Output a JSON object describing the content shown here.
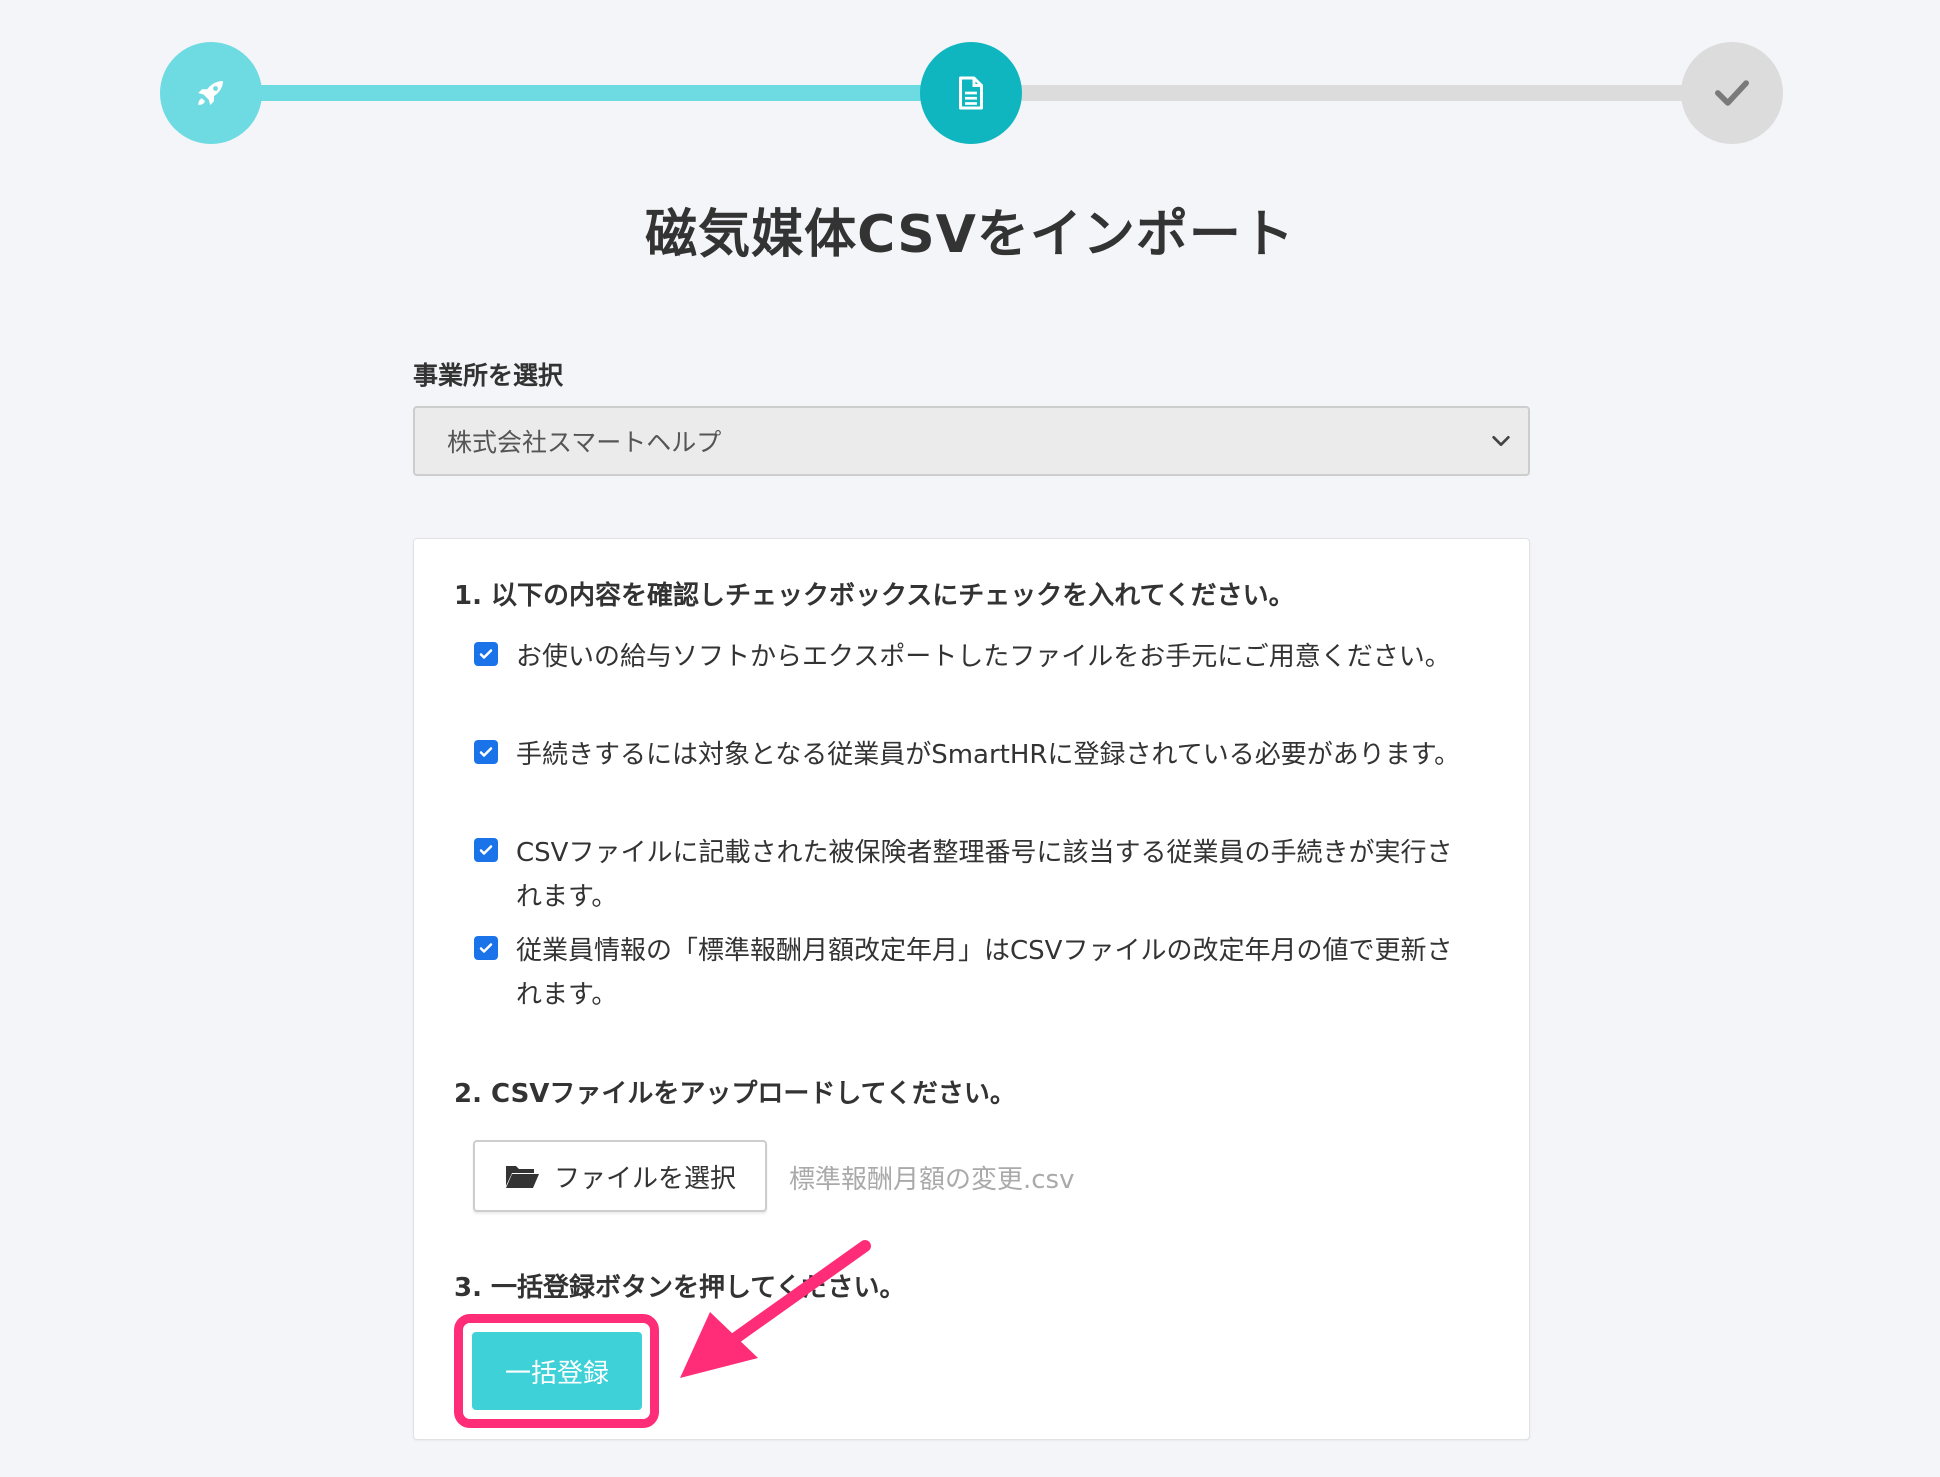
{
  "stepper": {
    "steps": [
      {
        "icon": "rocket-icon",
        "state": "completed"
      },
      {
        "icon": "document-icon",
        "state": "current"
      },
      {
        "icon": "check-icon",
        "state": "upcoming"
      }
    ],
    "colors": {
      "done": "#6ddbe1",
      "current": "#10b6bf",
      "todo": "#dcdcdc"
    }
  },
  "page": {
    "title": "磁気媒体CSVをインポート"
  },
  "office": {
    "label": "事業所を選択",
    "selected": "株式会社スマートヘルプ"
  },
  "section1": {
    "heading": "1. 以下の内容を確認しチェックボックスにチェックを入れてください。",
    "items": [
      {
        "text": "お使いの給与ソフトからエクスポートしたファイルをお手元にご用意ください。",
        "checked": true
      },
      {
        "text": "手続きするには対象となる従業員がSmartHRに登録されている必要があります。",
        "checked": true
      },
      {
        "text": "CSVファイルに記載された被保険者整理番号に該当する従業員の手続きが実行されます。",
        "checked": true
      },
      {
        "text": "従業員情報の「標準報酬月額改定年月」はCSVファイルの改定年月の値で更新されます。",
        "checked": true
      }
    ]
  },
  "section2": {
    "heading": "2. CSVファイルをアップロードしてください。",
    "file_button": "ファイルを選択",
    "file_name": "標準報酬月額の変更.csv"
  },
  "section3": {
    "heading": "3. 一括登録ボタンを押してください。",
    "submit_button": "一括登録"
  },
  "annotation": {
    "highlight_color": "#ff2d77"
  }
}
